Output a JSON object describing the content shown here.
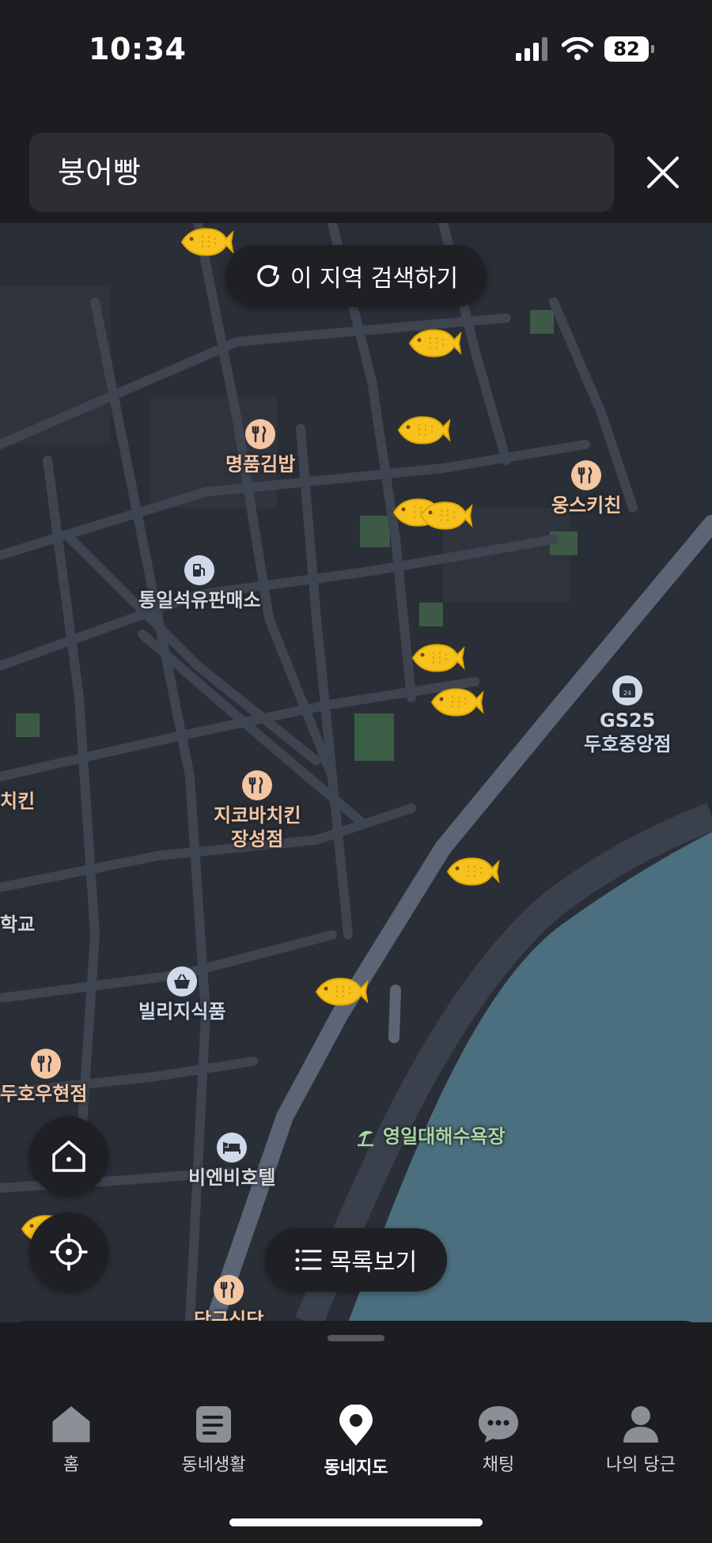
{
  "status": {
    "time": "10:34",
    "battery": "82"
  },
  "search": {
    "query": "붕어빵"
  },
  "map": {
    "search_area_button": "이 지역 검색하기",
    "list_button": "목록보기",
    "places": {
      "p1": "명품김밥",
      "p2": "웅스키친",
      "p3": "통일석유판매소",
      "p4": "GS25\n두호중앙점",
      "p5": "지코바치킨\n장성점",
      "p6": "치킨",
      "p7": "학교",
      "p8": "빌리지식품",
      "p9": "두호우현점",
      "p10": "영일대해수욕장",
      "p11": "비엔비호텔",
      "p12": "당구식당"
    }
  },
  "tabs": [
    {
      "label": "홈",
      "icon": "home-icon"
    },
    {
      "label": "동네생활",
      "icon": "board-icon"
    },
    {
      "label": "동네지도",
      "icon": "map-pin-icon"
    },
    {
      "label": "채팅",
      "icon": "chat-icon"
    },
    {
      "label": "나의 당근",
      "icon": "person-icon"
    }
  ],
  "colors": {
    "accent_fish": "#f7c21d",
    "sea": "#4c6f7f",
    "road": "#3e4450",
    "food_poi": "#f4c6a2",
    "store_poi": "#cfd9ea"
  }
}
